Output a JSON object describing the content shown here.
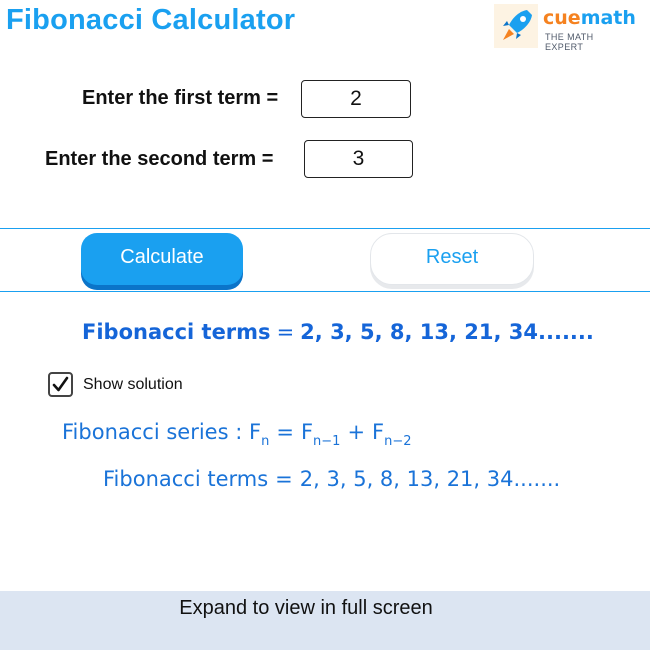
{
  "header": {
    "title": "Fibonacci Calculator",
    "logo": {
      "brand_part1": "cue",
      "brand_part2": "math",
      "tagline": "THE MATH EXPERT",
      "icon": "rocket-icon"
    }
  },
  "form": {
    "first_term_label": "Enter the first term =",
    "first_term_value": "2",
    "second_term_label": "Enter the second term =",
    "second_term_value": "3"
  },
  "actions": {
    "calculate_label": "Calculate",
    "reset_label": "Reset"
  },
  "result": {
    "label": "Fibonacci terms",
    "equals": "=",
    "value": "2, 3, 5, 8, 13, 21, 34......."
  },
  "solution_toggle": {
    "label": "Show solution",
    "checked": true
  },
  "solution": {
    "series_label": "Fibonacci series :",
    "f": "F",
    "sub_n": "n",
    "equals": "=",
    "sub_n_minus_1": "n−1",
    "plus": "+",
    "sub_n_minus_2": "n−2",
    "terms_label": "Fibonacci terms",
    "terms_value": "2, 3, 5, 8, 13, 21, 34......."
  },
  "footer": {
    "text": "Expand to view in full screen"
  },
  "colors": {
    "accent": "#1aa0f0",
    "result_text": "#1565d8",
    "footer_bg": "#dce5f2",
    "brand_orange": "#f58220"
  }
}
